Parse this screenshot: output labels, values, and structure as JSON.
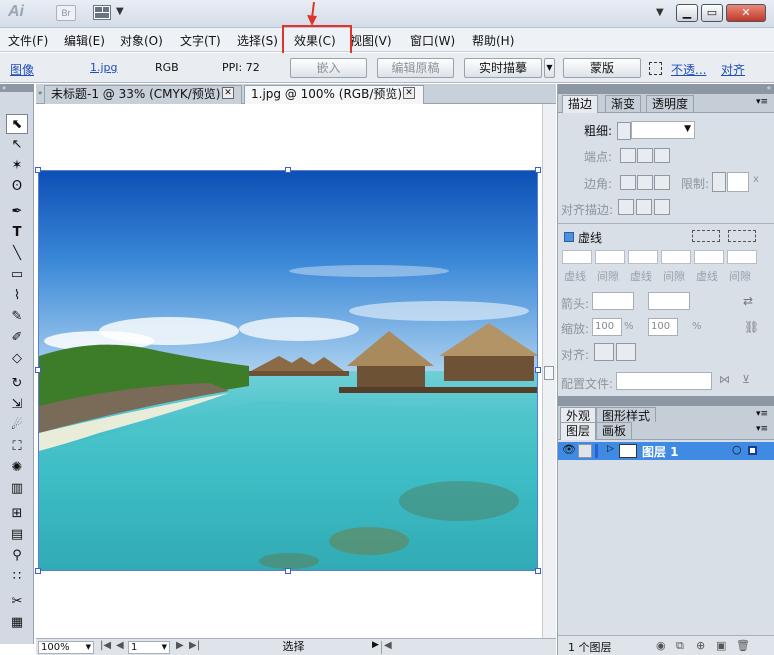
{
  "app": {
    "logo": "Ai",
    "bridge": "Br"
  },
  "menu": [
    "文件(F)",
    "编辑(E)",
    "对象(O)",
    "文字(T)",
    "选择(S)",
    "效果(C)",
    "视图(V)",
    "窗口(W)",
    "帮助(H)"
  ],
  "control": {
    "kind": "图像",
    "file": "1.jpg",
    "mode": "RGB",
    "ppi": "PPI: 72",
    "embed": "嵌入",
    "edit_original": "编辑原稿",
    "live_trace": "实时描摹",
    "mask": "蒙版",
    "opacity": "不透...",
    "align": "对齐"
  },
  "tabs": [
    {
      "label": "未标题-1 @ 33% (CMYK/预览)",
      "close": "✕"
    },
    {
      "label": "1.jpg @ 100% (RGB/预览)",
      "close": "✕"
    }
  ],
  "status": {
    "zoom": "100%",
    "page": "1",
    "tool": "选择"
  },
  "stroke_panel": {
    "tabs": [
      "描边",
      "渐变",
      "透明度"
    ],
    "weight": "粗细:",
    "cap": "端点:",
    "corner": "边角:",
    "limit": "限制:",
    "limit_x": "x",
    "align": "对齐描边:",
    "dashed": "虚线",
    "dash_labels": [
      "虚线",
      "间隙",
      "虚线",
      "间隙",
      "虚线",
      "间隙"
    ],
    "arrow": "箭头:",
    "scale": "缩放:",
    "scale_a": "100",
    "scale_b": "100",
    "pct": "%",
    "align2": "对齐:",
    "profile": "配置文件:"
  },
  "appearance": {
    "tabs": [
      "外观",
      "图形样式"
    ]
  },
  "layers": {
    "tabs": [
      "图层",
      "画板"
    ],
    "layer_name": "图层 1",
    "count": "1 个图层"
  },
  "colors": {
    "accent": "#2f6fce",
    "highlight_box": "#e0332c",
    "layer_row": "#3f8ae2"
  }
}
